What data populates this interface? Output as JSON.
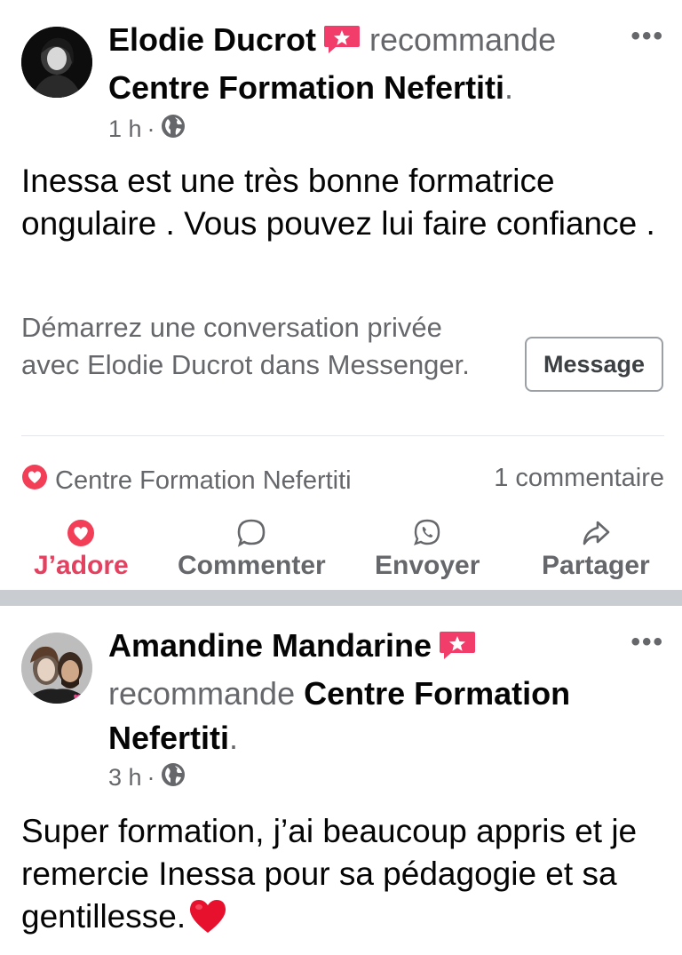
{
  "posts": [
    {
      "author": "Elodie Ducrot",
      "verb": "recommande",
      "page": "Centre Formation  Nefertiti",
      "time": "1 h",
      "text": "Inessa est une très bonne formatrice ongulaire . Vous pouvez lui faire confiance .",
      "conversation_prompt": "Démarrez une conversation privée avec Elodie Ducrot dans Messenger.",
      "message_button": "Message",
      "reaction_by": "Centre Formation  Nefertiti",
      "comment_count": "1 commentaire",
      "actions": {
        "love": "J’adore",
        "comment": "Commenter",
        "send": "Envoyer",
        "share": "Partager"
      }
    },
    {
      "author": "Amandine Mandarine",
      "verb": "recommande",
      "page": "Centre Formation  Nefertiti",
      "time": "3 h",
      "text": "Super formation, j’ai beaucoup appris et je remercie Inessa pour sa pédagogie et sa gentillesse."
    }
  ],
  "more_label": "•••",
  "colors": {
    "accent_love": "#e4405f",
    "text_primary": "#050505",
    "text_secondary": "#65676b",
    "divider": "#c9ccd1"
  },
  "icons": [
    "recommend-badge-icon",
    "globe-icon",
    "heart-icon",
    "comment-bubble-icon",
    "whatsapp-icon",
    "share-arrow-icon",
    "red-heart-emoji-icon",
    "more-options-icon"
  ]
}
